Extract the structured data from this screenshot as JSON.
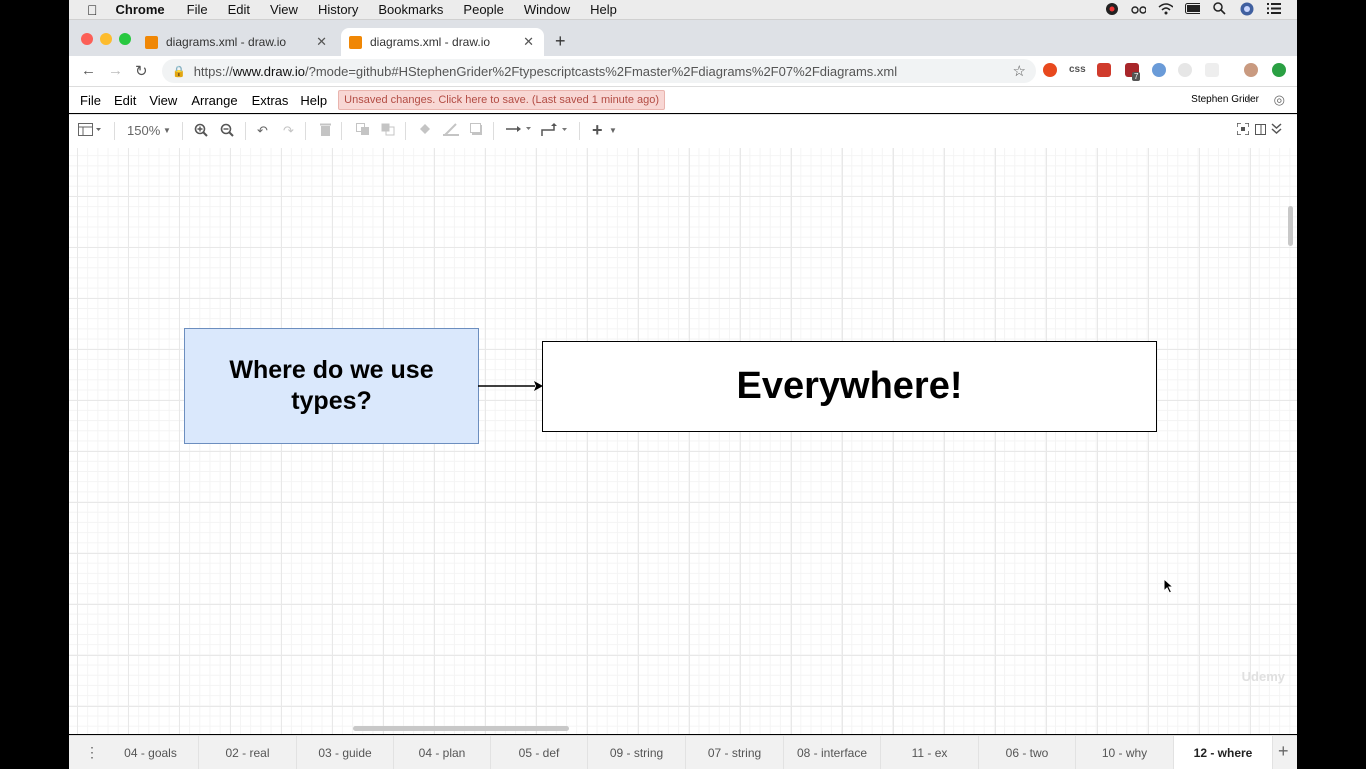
{
  "mac_menu": {
    "app": "Chrome",
    "items": [
      "File",
      "Edit",
      "View",
      "History",
      "Bookmarks",
      "People",
      "Window",
      "Help"
    ]
  },
  "browser": {
    "tabs": [
      {
        "title": "diagrams.xml - draw.io",
        "active": false
      },
      {
        "title": "diagrams.xml - draw.io",
        "active": true
      }
    ],
    "url_prefix": "https://",
    "url_domain": "www.draw.io",
    "url_rest": "/?mode=github#HStephenGrider%2Ftypescriptcasts%2Fmaster%2Fdiagrams%2F07%2Fdiagrams.xml",
    "ext_css_label": "css",
    "ext_badge": "7"
  },
  "drawio": {
    "menu": [
      "File",
      "Edit",
      "View",
      "Arrange",
      "Extras",
      "Help"
    ],
    "unsaved_notice": "Unsaved changes. Click here to save. (Last saved 1 minute ago)",
    "user": "Stephen Grider",
    "zoom": "150%",
    "shapes": {
      "left_box": "Where do we use types?",
      "right_box": "Everywhere!"
    },
    "watermark": "Udemy",
    "pages": [
      "04 - goals",
      "02 - real",
      "03 - guide",
      "04 - plan",
      "05 - def",
      "09 - string",
      "07 - string",
      "08 - interface",
      "11 - ex",
      "06 - two",
      "10 - why",
      "12 - where"
    ],
    "active_page": "12 - where"
  },
  "colors": {
    "left_box_fill": "#dae8fc",
    "left_box_stroke": "#6c8ebf",
    "unsaved_bg": "#f8d7d4",
    "drawio_orange": "#f08705"
  }
}
